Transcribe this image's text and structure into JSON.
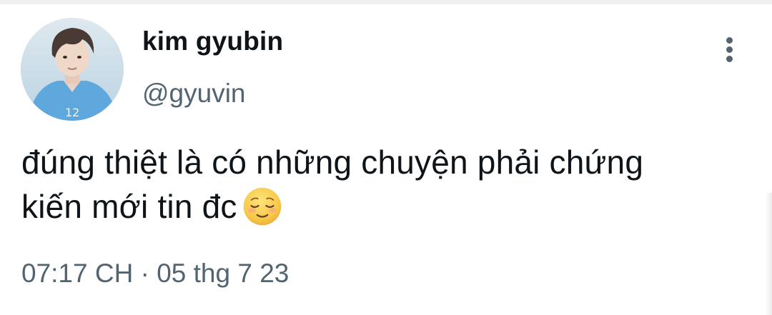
{
  "tweet": {
    "author": {
      "display_name": "kim gyubin",
      "handle": "@gyuvin",
      "avatar_icon": "profile-photo"
    },
    "text_lines": [
      "đúng thiệt là có những chuyện phải chứng",
      "kiến mới tin đc"
    ],
    "emoji": "relieved-face",
    "timestamp": "07:17 CH · 05 thg 7 23",
    "more_icon": "vertical-ellipsis-icon"
  },
  "colors": {
    "text_primary": "#0f1419",
    "text_secondary": "#536471",
    "background": "#ffffff",
    "emoji_face": "#f7c948"
  }
}
